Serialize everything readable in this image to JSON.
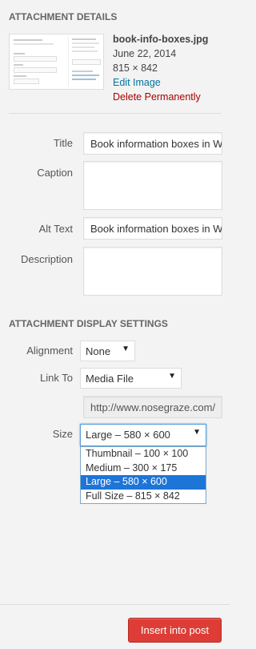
{
  "attachment_details": {
    "heading": "ATTACHMENT DETAILS",
    "filename": "book-info-boxes.jpg",
    "date": "June 22, 2014",
    "dimensions": "815 × 842",
    "edit_link": "Edit Image",
    "delete_link": "Delete Permanently"
  },
  "fields": {
    "title_label": "Title",
    "title_value": "Book information boxes in W",
    "caption_label": "Caption",
    "caption_value": "",
    "alt_label": "Alt Text",
    "alt_value": "Book information boxes in W",
    "description_label": "Description",
    "description_value": ""
  },
  "display_settings": {
    "heading": "ATTACHMENT DISPLAY SETTINGS",
    "alignment_label": "Alignment",
    "alignment_value": "None",
    "link_to_label": "Link To",
    "link_to_value": "Media File",
    "url_value": "http://www.nosegraze.com/",
    "size_label": "Size",
    "size_value": "Large – 580 × 600",
    "size_options": [
      "Thumbnail – 100 × 100",
      "Medium – 300 × 175",
      "Large – 580 × 600",
      "Full Size – 815 × 842"
    ],
    "size_selected_index": 2
  },
  "footer": {
    "insert_label": "Insert into post"
  },
  "colors": {
    "accent_link": "#0074a2",
    "delete": "#aa0000",
    "primary_button": "#dd3d36",
    "selected_option": "#1e75d8"
  }
}
